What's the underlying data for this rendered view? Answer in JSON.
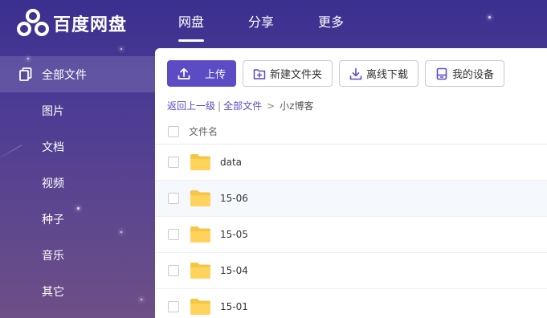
{
  "app": {
    "name": "百度网盘"
  },
  "topnav": [
    {
      "label": "网盘",
      "active": true
    },
    {
      "label": "分享",
      "active": false
    },
    {
      "label": "更多",
      "active": false
    }
  ],
  "sidebar": {
    "items": [
      {
        "label": "全部文件",
        "active": true,
        "icon": "files-icon"
      },
      {
        "label": "图片"
      },
      {
        "label": "文档"
      },
      {
        "label": "视频"
      },
      {
        "label": "种子"
      },
      {
        "label": "音乐"
      },
      {
        "label": "其它"
      }
    ]
  },
  "toolbar": {
    "upload_label": "上传",
    "new_folder_label": "新建文件夹",
    "offline_download_label": "离线下载",
    "my_devices_label": "我的设备"
  },
  "breadcrumb": {
    "back": "返回上一级",
    "divider": "|",
    "all_files": "全部文件",
    "separator": ">",
    "current": "小z博客"
  },
  "list": {
    "header": "文件名",
    "rows": [
      {
        "name": "data"
      },
      {
        "name": "15-06",
        "hover": true
      },
      {
        "name": "15-05"
      },
      {
        "name": "15-04"
      },
      {
        "name": "15-01"
      }
    ]
  },
  "colors": {
    "accent": "#5b4bc4",
    "folder": "#ffd35c",
    "bg_top": "#3b2f8f",
    "bg_bottom": "#6e4f86"
  }
}
